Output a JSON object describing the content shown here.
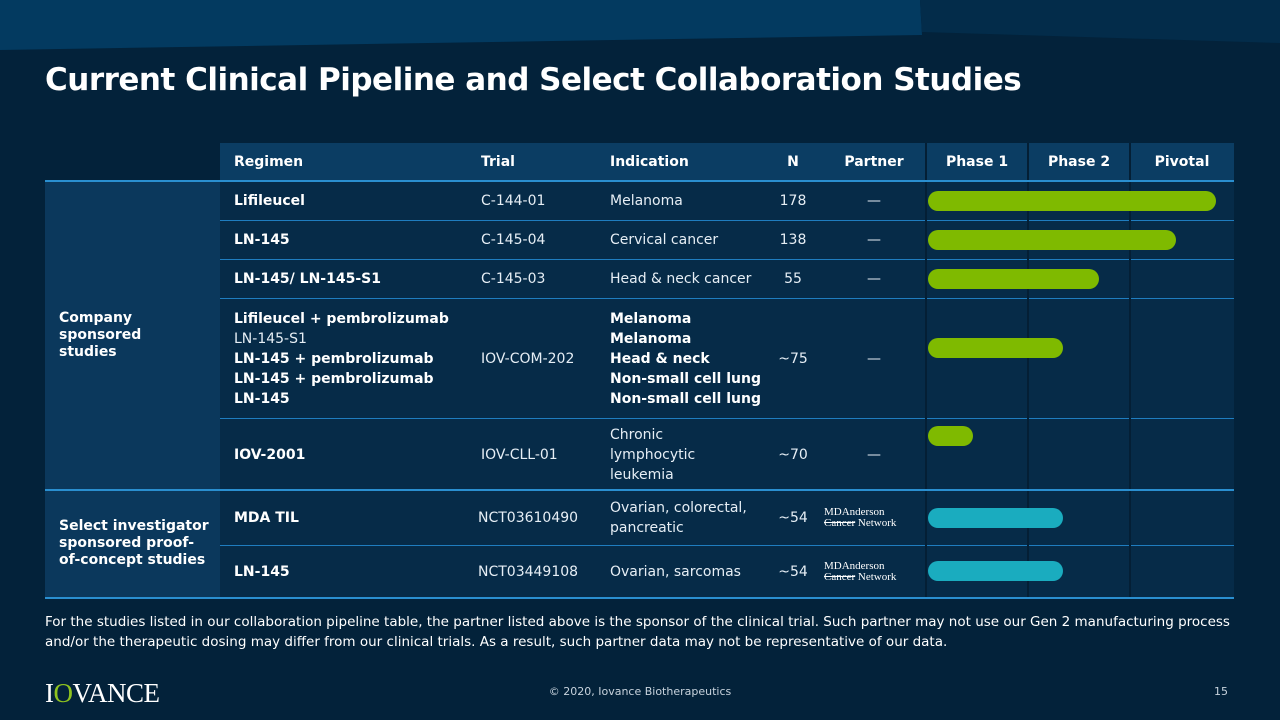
{
  "title": "Current Clinical Pipeline and Select Collaboration Studies",
  "colors": {
    "background": "#03223a",
    "header": "#0b3d63",
    "accent_line": "#2a8fd0",
    "company_bar": "#7fba00",
    "investigator_bar": "#1aacbf"
  },
  "table": {
    "headers": {
      "regimen": "Regimen",
      "trial": "Trial",
      "indication": "Indication",
      "n": "N",
      "partner": "Partner",
      "phase1": "Phase 1",
      "phase2": "Phase 2",
      "pivotal": "Pivotal"
    },
    "groups": [
      {
        "label": "Company sponsored studies",
        "rows": [
          0,
          1,
          2,
          3,
          4
        ]
      },
      {
        "label": "Select investigator sponsored proof-of-concept studies",
        "rows": [
          5,
          6
        ]
      }
    ],
    "rows": [
      {
        "regimen": [
          {
            "text": "Lifileucel",
            "bold": true
          }
        ],
        "trial": "C-144-01",
        "indication": [
          {
            "text": "Melanoma",
            "bold": false
          }
        ],
        "n": "178",
        "partner": "—",
        "progress_phases": 2.84,
        "bar": "company"
      },
      {
        "regimen": [
          {
            "text": "LN-145",
            "bold": true
          }
        ],
        "trial": "C-145-04",
        "indication": [
          {
            "text": "Cervical cancer",
            "bold": false
          }
        ],
        "n": "138",
        "partner": "—",
        "progress_phases": 2.45,
        "bar": "company"
      },
      {
        "regimen": [
          {
            "text": "LN-145/ LN-145-S1",
            "bold": true
          }
        ],
        "trial": "C-145-03",
        "indication": [
          {
            "text": "Head & neck cancer",
            "bold": false
          }
        ],
        "n": "55",
        "partner": "—",
        "progress_phases": 1.7,
        "bar": "company"
      },
      {
        "regimen": [
          {
            "text": "Lifileucel + pembrolizumab",
            "bold": true
          },
          {
            "text": "LN-145-S1",
            "bold": false
          },
          {
            "text": "LN-145 + pembrolizumab",
            "bold": true
          },
          {
            "text": "LN-145 + pembrolizumab",
            "bold": true
          },
          {
            "text": "LN-145",
            "bold": true
          }
        ],
        "trial": "IOV-COM-202",
        "indication": [
          {
            "text": "Melanoma",
            "bold": true
          },
          {
            "text": "Melanoma",
            "bold": true
          },
          {
            "text": "Head & neck",
            "bold": true
          },
          {
            "text": "Non-small cell lung",
            "bold": true
          },
          {
            "text": "Non-small cell lung",
            "bold": true
          }
        ],
        "n": "~75",
        "partner": "—",
        "progress_phases": 1.34,
        "bar": "company"
      },
      {
        "regimen": [
          {
            "text": "IOV-2001",
            "bold": true
          }
        ],
        "trial": "IOV-CLL-01",
        "indication": [
          {
            "text": "Chronic",
            "bold": false
          },
          {
            "text": "lymphocytic",
            "bold": false
          },
          {
            "text": "leukemia",
            "bold": false
          }
        ],
        "n": "~70",
        "partner": "—",
        "progress_phases": 0.46,
        "bar": "company"
      },
      {
        "regimen": [
          {
            "text": "MDA TIL",
            "bold": true
          }
        ],
        "trial": "NCT03610490",
        "indication": [
          {
            "text": "Ovarian, colorectal,",
            "bold": false
          },
          {
            "text": "pancreatic",
            "bold": false
          }
        ],
        "n": "~54",
        "partner_logo": {
          "line1": "MDAnderson",
          "line2a": "Cancer",
          "line2b": " Network"
        },
        "progress_phases": 1.34,
        "bar": "investigator"
      },
      {
        "regimen": [
          {
            "text": "LN-145",
            "bold": true
          }
        ],
        "trial": "NCT03449108",
        "indication": [
          {
            "text": "Ovarian, sarcomas",
            "bold": false
          }
        ],
        "n": "~54",
        "partner_logo": {
          "line1": "MDAnderson",
          "line2a": "Cancer",
          "line2b": " Network"
        },
        "progress_phases": 1.34,
        "bar": "investigator"
      }
    ]
  },
  "footnote": "For the studies listed in our collaboration pipeline table, the partner listed above is the sponsor of the clinical trial. Such partner may not use our Gen 2 manufacturing process and/or the therapeutic dosing may differ from our clinical trials. As a result, such partner data may not be representative of our data.",
  "footer": {
    "logo": "IOVANCE",
    "copyright": "© 2020, Iovance Biotherapeutics",
    "page": "15"
  }
}
